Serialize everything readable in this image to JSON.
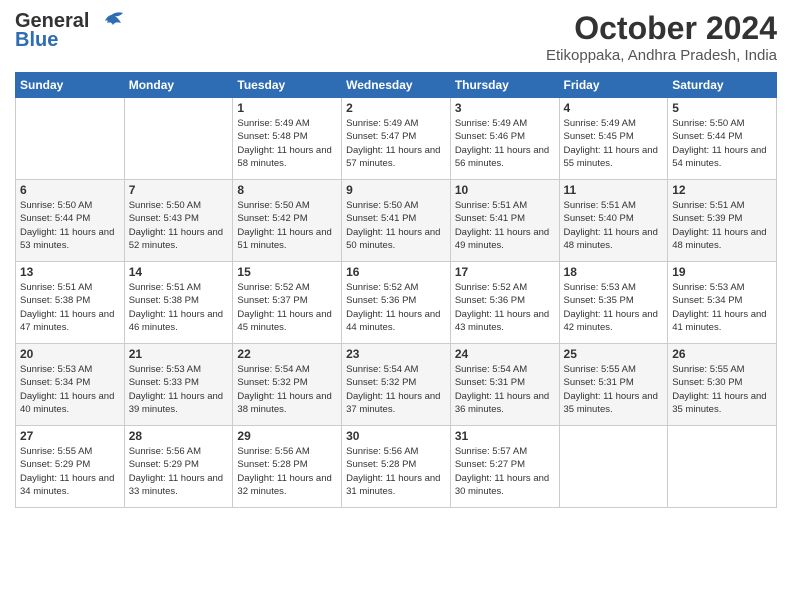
{
  "header": {
    "logo_line1": "General",
    "logo_line2": "Blue",
    "month": "October 2024",
    "location": "Etikoppaka, Andhra Pradesh, India"
  },
  "days_of_week": [
    "Sunday",
    "Monday",
    "Tuesday",
    "Wednesday",
    "Thursday",
    "Friday",
    "Saturday"
  ],
  "weeks": [
    [
      {
        "date": "",
        "info": ""
      },
      {
        "date": "",
        "info": ""
      },
      {
        "date": "1",
        "sunrise": "5:49 AM",
        "sunset": "5:48 PM",
        "daylight": "11 hours and 58 minutes."
      },
      {
        "date": "2",
        "sunrise": "5:49 AM",
        "sunset": "5:47 PM",
        "daylight": "11 hours and 57 minutes."
      },
      {
        "date": "3",
        "sunrise": "5:49 AM",
        "sunset": "5:46 PM",
        "daylight": "11 hours and 56 minutes."
      },
      {
        "date": "4",
        "sunrise": "5:49 AM",
        "sunset": "5:45 PM",
        "daylight": "11 hours and 55 minutes."
      },
      {
        "date": "5",
        "sunrise": "5:50 AM",
        "sunset": "5:44 PM",
        "daylight": "11 hours and 54 minutes."
      }
    ],
    [
      {
        "date": "6",
        "sunrise": "5:50 AM",
        "sunset": "5:44 PM",
        "daylight": "11 hours and 53 minutes."
      },
      {
        "date": "7",
        "sunrise": "5:50 AM",
        "sunset": "5:43 PM",
        "daylight": "11 hours and 52 minutes."
      },
      {
        "date": "8",
        "sunrise": "5:50 AM",
        "sunset": "5:42 PM",
        "daylight": "11 hours and 51 minutes."
      },
      {
        "date": "9",
        "sunrise": "5:50 AM",
        "sunset": "5:41 PM",
        "daylight": "11 hours and 50 minutes."
      },
      {
        "date": "10",
        "sunrise": "5:51 AM",
        "sunset": "5:41 PM",
        "daylight": "11 hours and 49 minutes."
      },
      {
        "date": "11",
        "sunrise": "5:51 AM",
        "sunset": "5:40 PM",
        "daylight": "11 hours and 48 minutes."
      },
      {
        "date": "12",
        "sunrise": "5:51 AM",
        "sunset": "5:39 PM",
        "daylight": "11 hours and 48 minutes."
      }
    ],
    [
      {
        "date": "13",
        "sunrise": "5:51 AM",
        "sunset": "5:38 PM",
        "daylight": "11 hours and 47 minutes."
      },
      {
        "date": "14",
        "sunrise": "5:51 AM",
        "sunset": "5:38 PM",
        "daylight": "11 hours and 46 minutes."
      },
      {
        "date": "15",
        "sunrise": "5:52 AM",
        "sunset": "5:37 PM",
        "daylight": "11 hours and 45 minutes."
      },
      {
        "date": "16",
        "sunrise": "5:52 AM",
        "sunset": "5:36 PM",
        "daylight": "11 hours and 44 minutes."
      },
      {
        "date": "17",
        "sunrise": "5:52 AM",
        "sunset": "5:36 PM",
        "daylight": "11 hours and 43 minutes."
      },
      {
        "date": "18",
        "sunrise": "5:53 AM",
        "sunset": "5:35 PM",
        "daylight": "11 hours and 42 minutes."
      },
      {
        "date": "19",
        "sunrise": "5:53 AM",
        "sunset": "5:34 PM",
        "daylight": "11 hours and 41 minutes."
      }
    ],
    [
      {
        "date": "20",
        "sunrise": "5:53 AM",
        "sunset": "5:34 PM",
        "daylight": "11 hours and 40 minutes."
      },
      {
        "date": "21",
        "sunrise": "5:53 AM",
        "sunset": "5:33 PM",
        "daylight": "11 hours and 39 minutes."
      },
      {
        "date": "22",
        "sunrise": "5:54 AM",
        "sunset": "5:32 PM",
        "daylight": "11 hours and 38 minutes."
      },
      {
        "date": "23",
        "sunrise": "5:54 AM",
        "sunset": "5:32 PM",
        "daylight": "11 hours and 37 minutes."
      },
      {
        "date": "24",
        "sunrise": "5:54 AM",
        "sunset": "5:31 PM",
        "daylight": "11 hours and 36 minutes."
      },
      {
        "date": "25",
        "sunrise": "5:55 AM",
        "sunset": "5:31 PM",
        "daylight": "11 hours and 35 minutes."
      },
      {
        "date": "26",
        "sunrise": "5:55 AM",
        "sunset": "5:30 PM",
        "daylight": "11 hours and 35 minutes."
      }
    ],
    [
      {
        "date": "27",
        "sunrise": "5:55 AM",
        "sunset": "5:29 PM",
        "daylight": "11 hours and 34 minutes."
      },
      {
        "date": "28",
        "sunrise": "5:56 AM",
        "sunset": "5:29 PM",
        "daylight": "11 hours and 33 minutes."
      },
      {
        "date": "29",
        "sunrise": "5:56 AM",
        "sunset": "5:28 PM",
        "daylight": "11 hours and 32 minutes."
      },
      {
        "date": "30",
        "sunrise": "5:56 AM",
        "sunset": "5:28 PM",
        "daylight": "11 hours and 31 minutes."
      },
      {
        "date": "31",
        "sunrise": "5:57 AM",
        "sunset": "5:27 PM",
        "daylight": "11 hours and 30 minutes."
      },
      {
        "date": "",
        "info": ""
      },
      {
        "date": "",
        "info": ""
      }
    ]
  ],
  "labels": {
    "sunrise": "Sunrise:",
    "sunset": "Sunset:",
    "daylight": "Daylight:"
  }
}
